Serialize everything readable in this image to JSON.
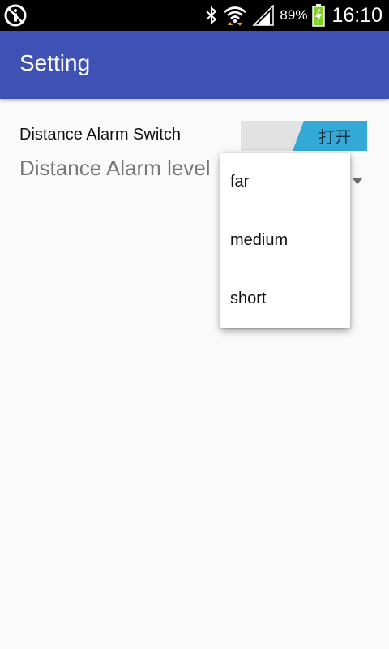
{
  "status_bar": {
    "battery_percent": "89%",
    "time": "16:10",
    "icons": [
      "info-circle-icon",
      "bluetooth-icon",
      "wifi-icon",
      "signal-icon",
      "battery-charging-icon"
    ]
  },
  "app_bar": {
    "title": "Setting",
    "color": "#3f51b5"
  },
  "settings": {
    "distance_alarm_switch": {
      "label": "Distance Alarm Switch",
      "state_text": "打开",
      "on_color": "#33a9d8"
    },
    "distance_alarm_level": {
      "label": "Distance Alarm level"
    }
  },
  "dropdown": {
    "options": [
      "far",
      "medium",
      "short"
    ]
  }
}
